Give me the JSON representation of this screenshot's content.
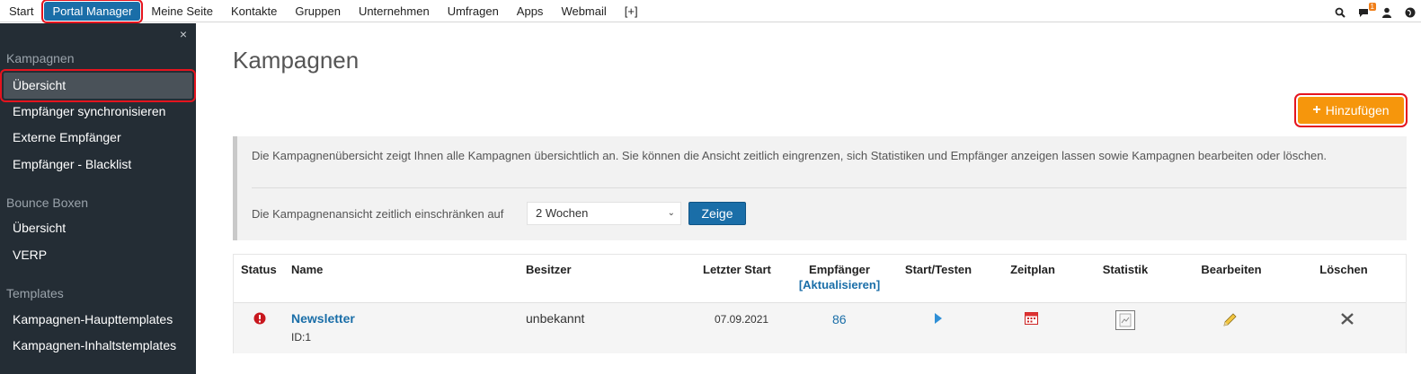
{
  "topnav": {
    "items": [
      "Start",
      "Portal Manager",
      "Meine Seite",
      "Kontakte",
      "Gruppen",
      "Unternehmen",
      "Umfragen",
      "Apps",
      "Webmail",
      "[+]"
    ],
    "notification_count": "1"
  },
  "sidebar": {
    "close": "×",
    "sections": [
      {
        "title": "Kampagnen",
        "links": [
          "Übersicht",
          "Empfänger synchronisieren",
          "Externe Empfänger",
          "Empfänger - Blacklist"
        ]
      },
      {
        "title": "Bounce Boxen",
        "links": [
          "Übersicht",
          "VERP"
        ]
      },
      {
        "title": "Templates",
        "links": [
          "Kampagnen-Haupttemplates",
          "Kampagnen-Inhaltstemplates"
        ]
      }
    ]
  },
  "main": {
    "title": "Kampagnen",
    "add_button": "Hinzufügen",
    "description": "Die Kampagnenübersicht zeigt Ihnen alle Kampagnen übersichtlich an. Sie können die Ansicht zeitlich eingrenzen, sich Statistiken und Empfänger anzeigen lassen sowie Kampagnen bearbeiten oder löschen.",
    "filter_label": "Die Kampagnenansicht zeitlich einschränken auf",
    "filter_value": "2 Wochen",
    "filter_button": "Zeige",
    "table": {
      "headers": {
        "status": "Status",
        "name": "Name",
        "owner": "Besitzer",
        "last_start": "Letzter Start",
        "recipients": "Empfänger",
        "refresh": "[Aktualisieren]",
        "start_test": "Start/Testen",
        "schedule": "Zeitplan",
        "stats": "Statistik",
        "edit": "Bearbeiten",
        "delete": "Löschen"
      },
      "rows": [
        {
          "name": "Newsletter",
          "id": "ID:1",
          "owner": "unbekannt",
          "last_start": "07.09.2021",
          "recipients": "86"
        }
      ]
    }
  },
  "colors": {
    "accent": "#1a6ea8",
    "add": "#f6960c",
    "sidebar": "#242d35",
    "highlight": "#e5141e"
  }
}
